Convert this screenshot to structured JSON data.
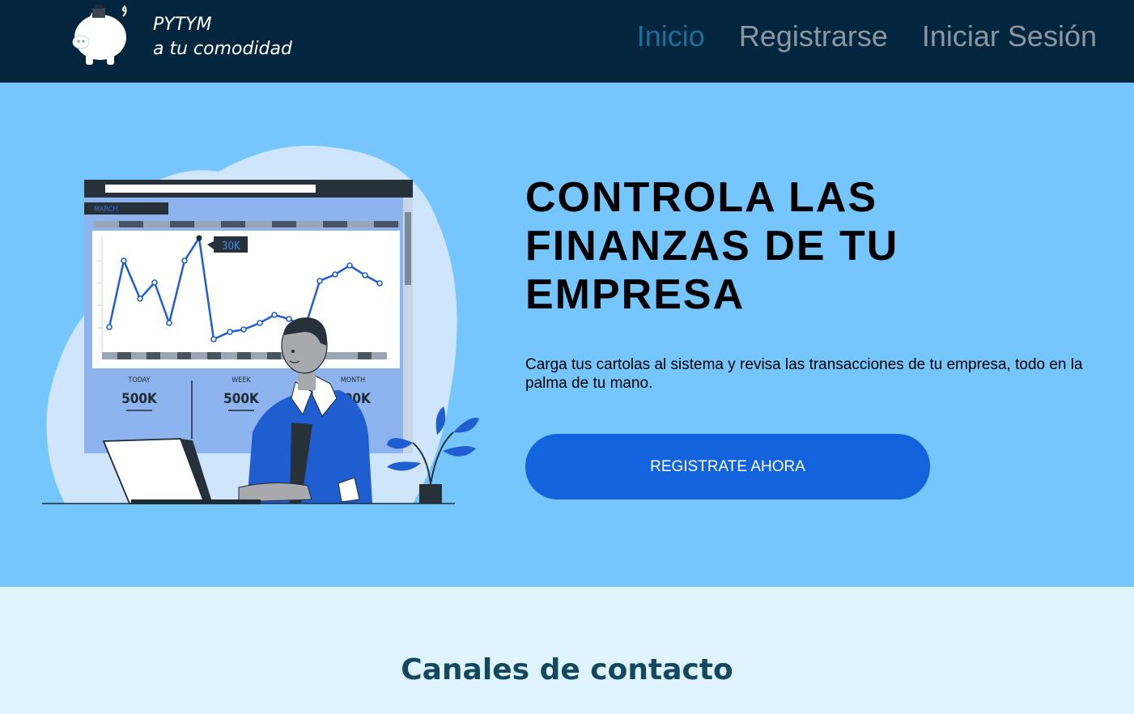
{
  "brand": {
    "name": "PYTYM",
    "tagline": "a tu comodidad",
    "logo_icon": "piggy-bank-icon"
  },
  "nav": {
    "items": [
      {
        "label": "Inicio",
        "active": true
      },
      {
        "label": "Registrarse",
        "active": false
      },
      {
        "label": "Iniciar Sesión",
        "active": false
      }
    ]
  },
  "hero": {
    "title_lines": [
      "CONTROLA LAS",
      "FINANZAS DE TU",
      "EMPRESA"
    ],
    "text": "Carga tus cartolas al sistema y revisa las transacciones de tu empresa, todo en la palma de tu mano.",
    "cta_label": "REGISTRATE AHORA",
    "illustration": {
      "month_label": "MARCH",
      "peak_label": "30K",
      "stats": [
        {
          "label": "TODAY",
          "value": "500K"
        },
        {
          "label": "WEEK",
          "value": "500K"
        },
        {
          "label": "MONTH",
          "value": "500K"
        }
      ]
    }
  },
  "contact": {
    "title": "Canales de contacto"
  },
  "colors": {
    "navbar": "#03263e",
    "hero_bg": "#76c6fe",
    "accent": "#1363de",
    "nav_active": "#1b6f9a",
    "nav_inactive": "#8a97a1",
    "footer_bg": "#dff4fd"
  }
}
